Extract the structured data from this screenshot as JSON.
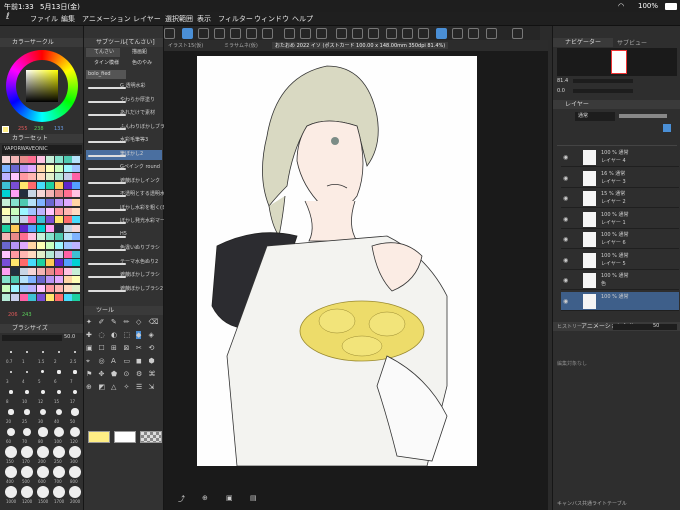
{
  "status": {
    "time": "午前1:33",
    "date": "5月13日(金)",
    "battery": "100%"
  },
  "menu": [
    "ファイル",
    "編集",
    "アニメーション",
    "レイヤー",
    "選択範囲",
    "表示",
    "フィルター",
    "ウィンドウ",
    "ヘルプ"
  ],
  "left": {
    "color_wheel_title": "カラーサークル",
    "rgb_values": [
      "255",
      "238",
      "133"
    ],
    "color_set_title": "カラーセット",
    "color_set_name": "VAPORWAVEONIC",
    "rgb_values2": [
      "206",
      "243"
    ],
    "brush_size_title": "ブラシサイズ",
    "brush_size_value": "50.0",
    "brush_sizes": [
      "0.7",
      "1",
      "1.5",
      "2",
      "2.5",
      "3",
      "4",
      "5",
      "6",
      "7",
      "8",
      "10",
      "12",
      "15",
      "17",
      "20",
      "25",
      "30",
      "40",
      "50",
      "60",
      "70",
      "80",
      "100",
      "120",
      "150",
      "170",
      "200",
      "250",
      "300",
      "400",
      "500",
      "600",
      "700",
      "800",
      "1000",
      "1200",
      "1500",
      "1700",
      "2000"
    ],
    "tool_title": "ツール"
  },
  "subtool": {
    "title": "サブツール[てんさい]",
    "tabs": [
      "てんさい",
      "描画鉛",
      "タイン模様",
      "色のやみ"
    ],
    "selected_brush": "bolo_fied",
    "brushes": [
      "G 透明水彩",
      "やわらか厚塗り",
      "あれだけで素材",
      "ふんわりぼかしブラシ",
      "水彩毛筆等3",
      "筆ぼかし2",
      "Gペインク round",
      "遮蔽ぼかしインク",
      "不透明とする透明水彩",
      "ぼかし水彩を粗く(日)",
      "ぼかし発光水彩マーカー2",
      "H5",
      "色違いぬりブラシ",
      "テーマ水色ぬり2",
      "遮蔽ぼかしブラシ",
      "遮蔽ぼかしブラシ2"
    ]
  },
  "doc": {
    "tabs": [
      "イラスト15(仮)",
      "ミラサムネ(仮)",
      "おたおめ 2022 イソ (ポストカード 100.00 x 148.00mm 350dpi 81.4%)"
    ]
  },
  "right": {
    "navigator_title": "ナビゲーター",
    "navigator_tab2": "サブビュー",
    "zoom": "81.4",
    "rotation": "0.0",
    "layer_title": "レイヤー",
    "blend_mode": "通常",
    "opacity_value": "100",
    "layers": [
      {
        "opacity": "100 %",
        "mode": "通常",
        "name": "レイヤー 4"
      },
      {
        "opacity": "16 %",
        "mode": "通常",
        "name": "レイヤー 3"
      },
      {
        "opacity": "15 %",
        "mode": "通常",
        "name": "レイヤー 2"
      },
      {
        "opacity": "100 %",
        "mode": "通常",
        "name": "レイヤー 1"
      },
      {
        "opacity": "100 %",
        "mode": "通常",
        "name": "レイヤー 6"
      },
      {
        "opacity": "100 %",
        "mode": "通常",
        "name": "レイヤー 5"
      },
      {
        "opacity": "100 %",
        "mode": "通常",
        "name": "色"
      },
      {
        "opacity": "100 %",
        "mode": "通常",
        "name": ""
      }
    ],
    "animation_cel_title": "アニメーションセル",
    "history_tab": "ヒストリー",
    "cel_value": "50",
    "no_edit": "編集対象なし",
    "footer": "キャンバス共通ライトテーブル"
  },
  "colors": {
    "accent": "#4a8fd6",
    "main_color": "#ffee85"
  }
}
